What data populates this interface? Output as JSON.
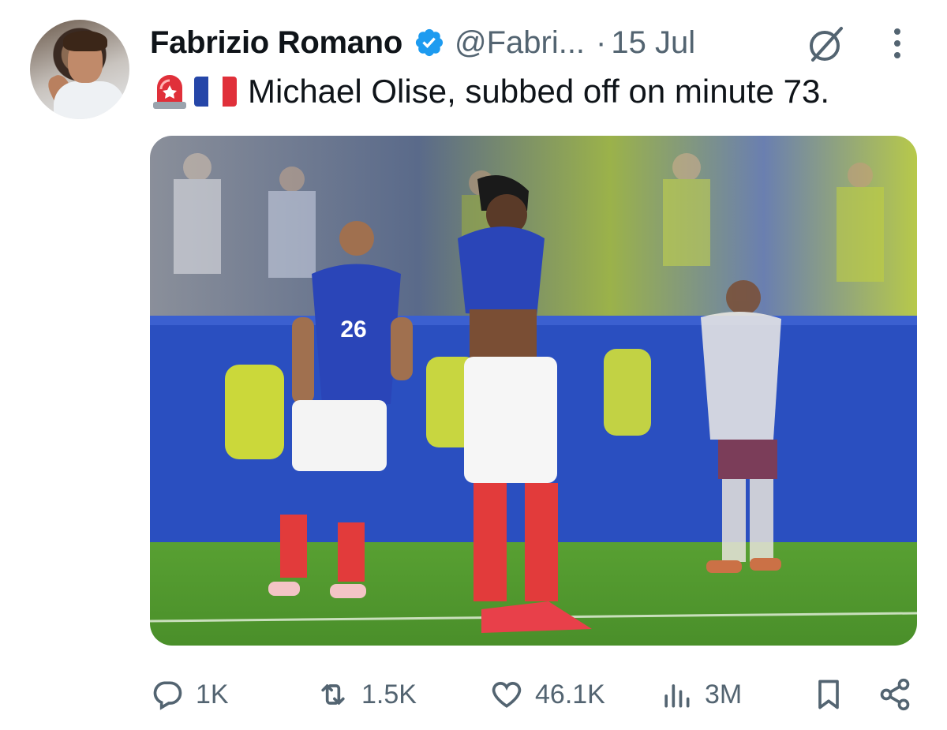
{
  "tweet": {
    "author_name": "Fabrizio Romano",
    "handle": "@Fabri...",
    "separator": "·",
    "date": "15 Jul",
    "verified": true,
    "emojis": [
      "siren-emoji",
      "france-flag-emoji"
    ],
    "text": "Michael Olise, subbed off on minute 73.",
    "media": {
      "description_icon": "photo",
      "player_number": "26"
    }
  },
  "actions": {
    "replies": "1K",
    "retweets": "1.5K",
    "likes": "46.1K",
    "views": "3M"
  },
  "colors": {
    "text_primary": "#0f1419",
    "text_secondary": "#536471",
    "verified_blue": "#1d9bf0",
    "pitch_green": "#4f9a2e",
    "france_blue": "#1f3b9a"
  }
}
